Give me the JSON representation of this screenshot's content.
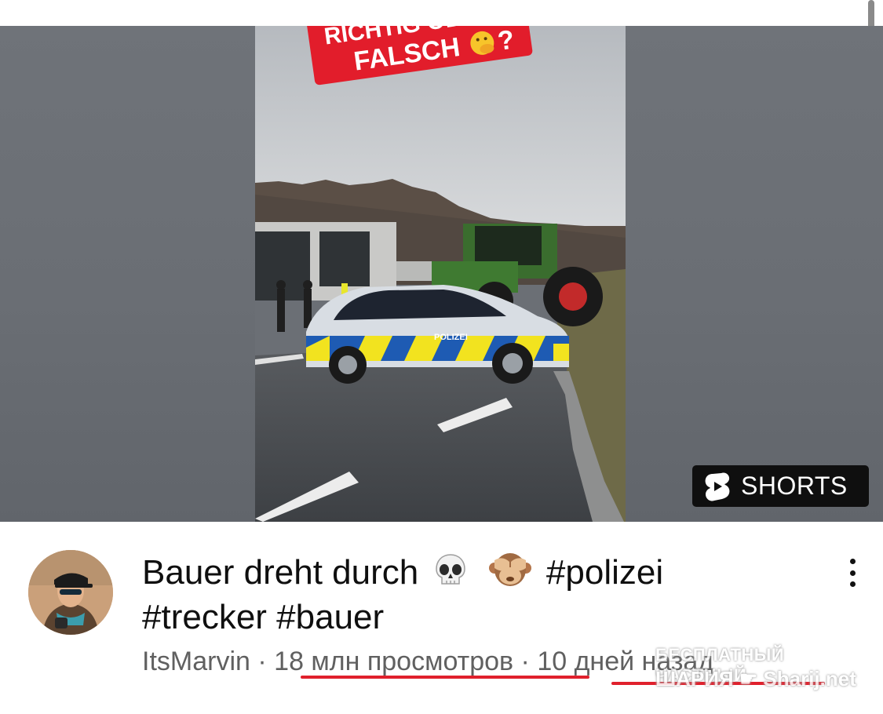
{
  "video": {
    "overlay_line1": "RICHTIG ODER",
    "overlay_line2": "FALSCH",
    "overlay_emoji": "face-with-hand-over-mouth-emoji",
    "overlay_suffix": "?",
    "car_text": "POLIZEI"
  },
  "badge": {
    "label": "SHORTS",
    "icon": "youtube-shorts-logo"
  },
  "video_info": {
    "title_part1": "Bauer dreht durch",
    "emoji1": "skull-emoji",
    "emoji2": "see-no-evil-monkey-emoji",
    "title_hashtag1": "#polizei",
    "title_line2": "#trecker #bauer",
    "channel": "ItsMarvin",
    "separator": "·",
    "views": "18 млн просмотров",
    "age": "10 дней назад",
    "menu_icon": "more-vertical-icon"
  },
  "watermark": {
    "line1": "БЕСПЛАТНЫЙ ЧАСТНЫЙ",
    "line2": "ШАРИЯ",
    "line2_suffix": "Sharij.net"
  },
  "colors": {
    "underline": "#e0202c",
    "badge_bg": "#0f0f0f",
    "overlay_red": "#e21d2b"
  }
}
